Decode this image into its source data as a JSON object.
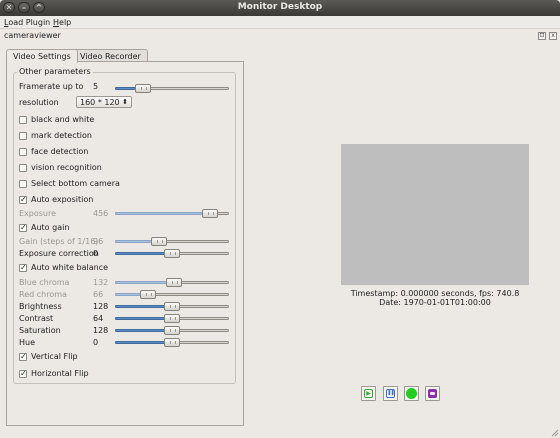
{
  "window": {
    "title": "Monitor Desktop",
    "close_glyph": "✕",
    "minimize_glyph": "–",
    "maximize_glyph": "^"
  },
  "menu": {
    "items": [
      {
        "label": "Load Plugin",
        "accel": "L",
        "rest": "oad Plugin"
      },
      {
        "label": "Help",
        "accel": "H",
        "rest": "elp"
      }
    ]
  },
  "dock": {
    "title": "cameraviewer",
    "float_glyph": "⊡",
    "close_glyph": "x"
  },
  "tabs": [
    {
      "label": "Video Settings",
      "active": true
    },
    {
      "label": "Video Recorder",
      "active": false
    }
  ],
  "group": {
    "title": "Other parameters"
  },
  "framerate": {
    "label": "Framerate up to",
    "value": "5",
    "level": 0.2
  },
  "resolution": {
    "label": "resolution",
    "selected": "160 * 120"
  },
  "checkboxes": {
    "black_and_white": {
      "label": "black and white",
      "checked": false
    },
    "mark_detection": {
      "label": "mark detection",
      "checked": false
    },
    "face_detection": {
      "label": "face detection",
      "checked": false
    },
    "vision_recognition": {
      "label": "vision recognition",
      "checked": false
    },
    "select_bottom_camera": {
      "label": "Select bottom camera",
      "checked": false
    },
    "auto_exposition": {
      "label": "Auto exposition",
      "checked": true
    },
    "auto_gain": {
      "label": "Auto gain",
      "checked": true
    },
    "auto_white_balance": {
      "label": "Auto white balance",
      "checked": true
    },
    "vertical_flip": {
      "label": "Vertical Flip",
      "checked": true
    },
    "horizontal_flip": {
      "label": "Horizontal Flip",
      "checked": true
    }
  },
  "exposure": {
    "label": "Exposure",
    "value": "456",
    "level": 0.89,
    "enabled": false
  },
  "gain": {
    "label": "Gain (steps of 1/16)",
    "value": "96",
    "level": 0.37,
    "enabled": false
  },
  "exposure_correction": {
    "label": "Exposure correction",
    "value": "0",
    "level": 0.5,
    "enabled": true
  },
  "blue_chroma": {
    "label": "Blue chroma",
    "value": "132",
    "level": 0.52,
    "enabled": false
  },
  "red_chroma": {
    "label": "Red chroma",
    "value": "66",
    "level": 0.26,
    "enabled": false
  },
  "brightness": {
    "label": "Brightness",
    "value": "128",
    "level": 0.5,
    "enabled": true
  },
  "contrast": {
    "label": "Contrast",
    "value": "64",
    "level": 0.5,
    "enabled": true
  },
  "saturation": {
    "label": "Saturation",
    "value": "128",
    "level": 0.5,
    "enabled": true
  },
  "hue": {
    "label": "Hue",
    "value": "0",
    "level": 0.5,
    "enabled": true
  },
  "status": {
    "timestamp": "Timestamp: 0.000000 seconds,  fps: 740.8",
    "date": "Date: 1970-01-01T01:00:00"
  },
  "controls": [
    {
      "name": "play-icon",
      "glyph": "▶",
      "color": "#3da33d"
    },
    {
      "name": "pause-icon",
      "glyph": "❚❚",
      "color": "#3a6fc4"
    },
    {
      "name": "record-icon",
      "glyph": "",
      "color": "#22cc22"
    },
    {
      "name": "snapshot-icon",
      "glyph": "",
      "color": "#8b2fa8"
    }
  ]
}
